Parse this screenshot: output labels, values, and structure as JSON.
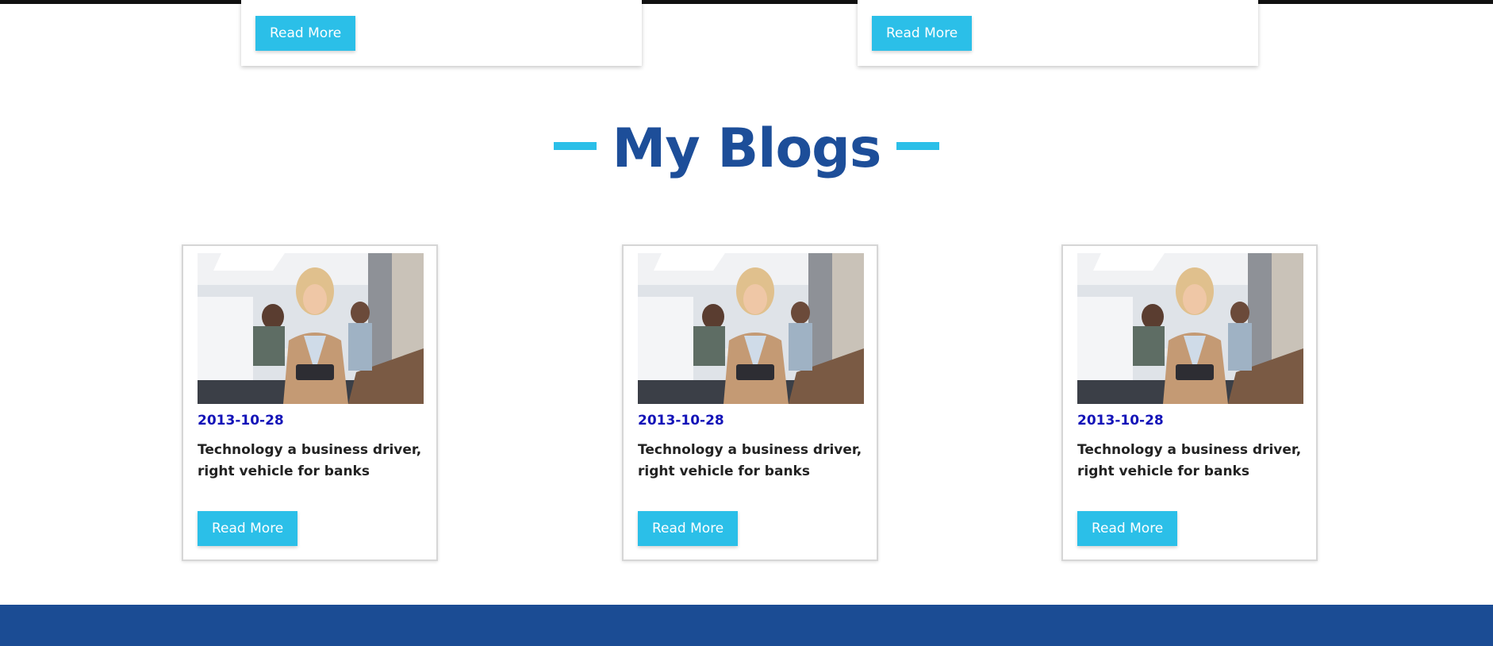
{
  "top_cards": [
    {
      "button_label": "Read More"
    },
    {
      "button_label": "Read More"
    }
  ],
  "section": {
    "title": "My Blogs"
  },
  "blogs": [
    {
      "date": "2013-10-28",
      "title": "Technology a business driver, right vehicle for banks",
      "button_label": "Read More"
    },
    {
      "date": "2013-10-28",
      "title": "Technology a business driver, right vehicle for banks",
      "button_label": "Read More"
    },
    {
      "date": "2013-10-28",
      "title": "Technology a business driver, right vehicle for banks",
      "button_label": "Read More"
    }
  ],
  "colors": {
    "accent": "#2bbfe8",
    "heading": "#1d4e99",
    "date": "#1414b8",
    "footer": "#1b4c94"
  }
}
